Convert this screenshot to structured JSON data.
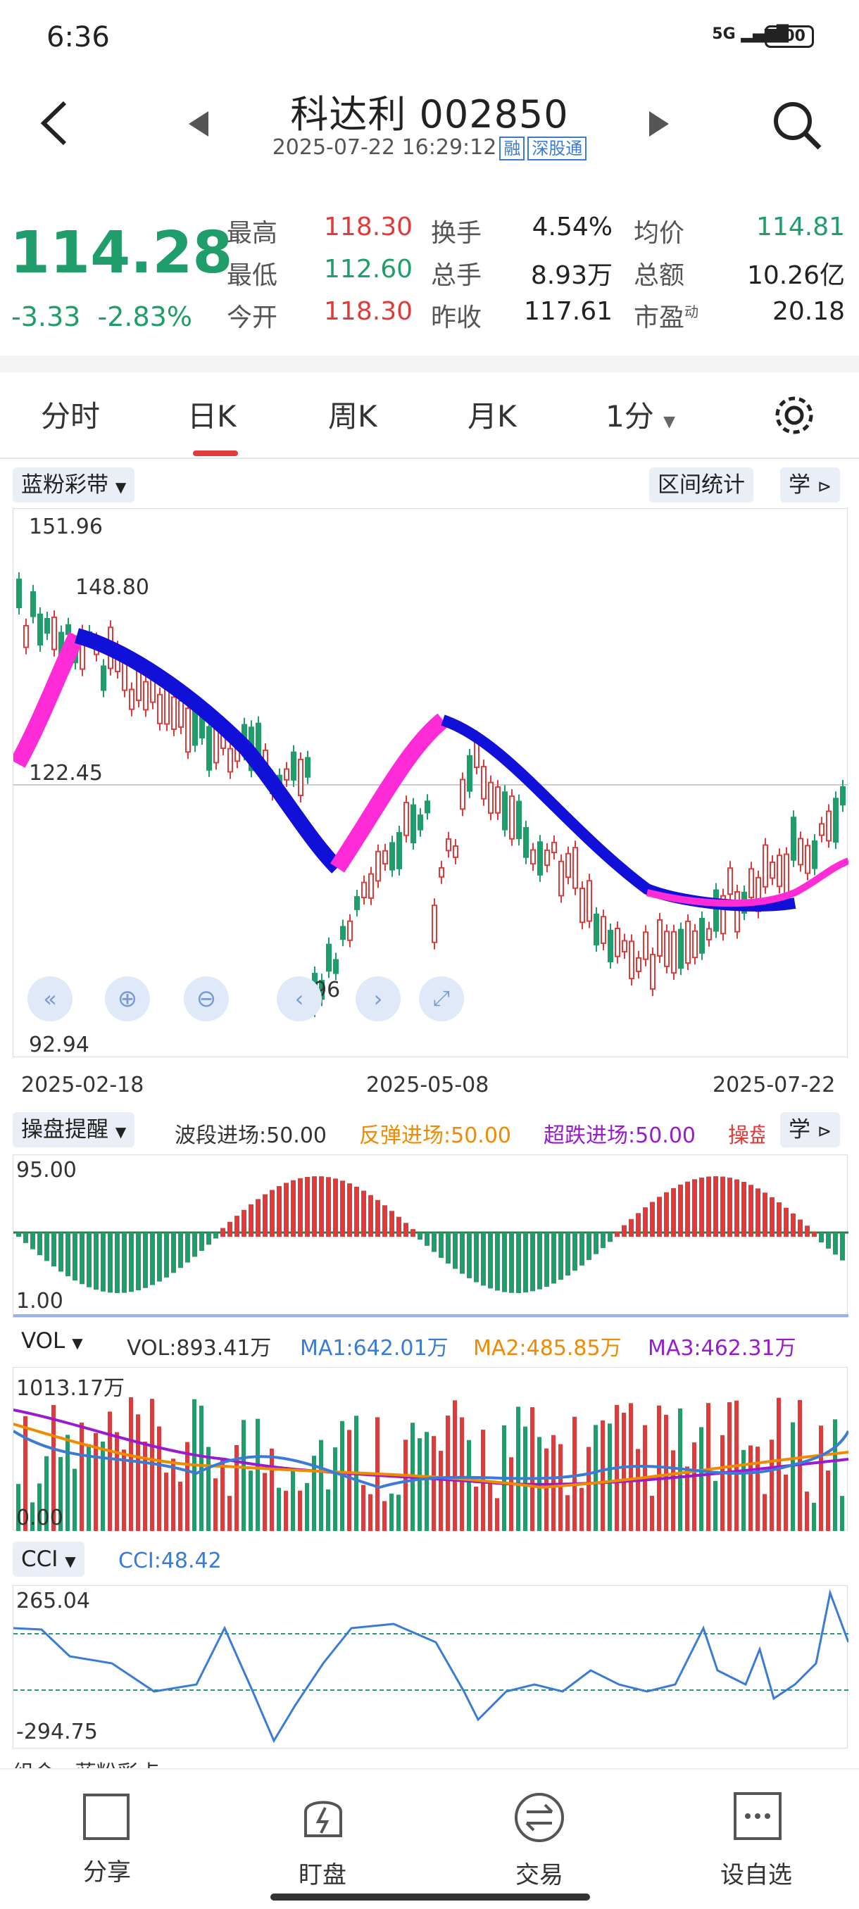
{
  "status": {
    "time": "6:36",
    "signal": "5G",
    "battery": "100"
  },
  "header": {
    "title": "科达利 002850",
    "datetime": "2025-07-22 16:29:12",
    "tag_rong": "融",
    "tag_sg": "深股通"
  },
  "quote": {
    "price": "114.28",
    "change": "-3.33",
    "change_pct": "-2.83%",
    "rows": [
      {
        "l1": "最高",
        "v1": "118.30",
        "l2": "换手",
        "v2": "4.54%",
        "l3": "均价",
        "v3": "114.81"
      },
      {
        "l1": "最低",
        "v1": "112.60",
        "l2": "总手",
        "v2": "8.93万",
        "l3": "总额",
        "v3": "10.26亿"
      },
      {
        "l1": "今开",
        "v1": "118.30",
        "l2": "昨收",
        "v2": "117.61",
        "l3": "市盈",
        "v3": "20.18"
      }
    ],
    "pe_sup": "动"
  },
  "tabs": [
    "分时",
    "日K",
    "周K",
    "月K",
    "1分"
  ],
  "kline": {
    "indicator_chip": "蓝粉彩带",
    "range_btn": "区间统计",
    "learn": "学",
    "high_label": "151.96",
    "high_label2": "148.80",
    "mid_label": "122.45",
    "low_label": "92.94",
    "low_mark": "96",
    "dates": [
      "2025-02-18",
      "2025-05-08",
      "2025-07-22"
    ]
  },
  "ops": {
    "chip": "操盘提醒",
    "s1": "波段进场:50.00",
    "s2": "反弹进场:50.00",
    "s3": "超跌进场:50.00",
    "s4": "操盘",
    "learn": "学",
    "top": "95.00",
    "bottom": "1.00"
  },
  "vol": {
    "chip": "VOL",
    "v": "VOL:893.41万",
    "ma1": "MA1:642.01万",
    "ma2": "MA2:485.85万",
    "ma3": "MA3:462.31万",
    "top": "1013.17万",
    "bottom": "0.00"
  },
  "cci": {
    "chip": "CCI",
    "v": "CCI:48.42",
    "top": "265.04",
    "bottom": "-294.75"
  },
  "bottom_peek": {
    "a": "组合",
    "b": "蓝粉彩点"
  },
  "footer": [
    "分享",
    "盯盘",
    "交易",
    "设自选"
  ],
  "colors": {
    "up": "#e03a3a",
    "down": "#1f9d6a",
    "band_blue": "#1010d8",
    "band_pink": "#ff2bd6"
  }
}
